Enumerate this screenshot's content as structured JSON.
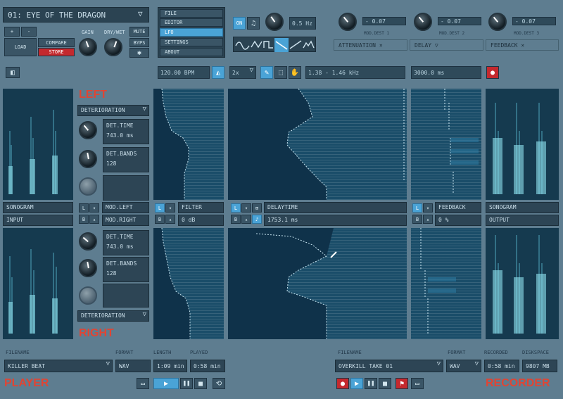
{
  "header": {
    "preset_name": "01: EYE OF THE DRAGON",
    "plus": "+",
    "minus": "-",
    "load": "LOAD",
    "compare": "COMPARE",
    "store": "STORE",
    "gain": "GAIN",
    "dry_wet": "DRY/WET",
    "mute": "MUTE",
    "byps": "BYPS"
  },
  "menu": [
    "FILE",
    "EDITOR",
    "LFO",
    "SETTINGS",
    "ABOUT"
  ],
  "lfo": {
    "on": "ON",
    "rate": "0.5 Hz"
  },
  "mod": {
    "items": [
      {
        "value": "- 0.07",
        "dest": "MOD.DEST 1",
        "label": "ATTENUATION"
      },
      {
        "value": "- 0.07",
        "dest": "MOD.DEST 2",
        "label": "DELAY"
      },
      {
        "value": "- 0.07",
        "dest": "MOD.DEST 3",
        "label": "FEEDBACK"
      }
    ],
    "attenuation_mark": "×",
    "delay_mark": "▽",
    "feedback_mark": "×"
  },
  "toolbar": {
    "bpm": "120.00 BPM",
    "multiplier": "2x",
    "freq_range": "1.38 - 1.46 kHz",
    "time": "3000.0 ms"
  },
  "channels": {
    "left": "LEFT",
    "right": "RIGHT",
    "deterioration": "DETERIORATION",
    "det_time": "DET.TIME",
    "det_time_value": "743.0 ms",
    "det_bands": "DET.BANDS",
    "det_bands_value": "128",
    "mod_left": "MOD.LEFT",
    "mod_right": "MOD.RIGHT"
  },
  "strips": {
    "sonogram": "SONOGRAM",
    "input": "INPUT",
    "filter": "FILTER",
    "filter_value": "0 dB",
    "delaytime": "DELAYTIME",
    "delaytime_value": "1753.1 ms",
    "feedback": "FEEDBACK",
    "feedback_value": "0 %",
    "sonogram_out": "SONOGRAM",
    "output": "OUTPUT",
    "l": "L",
    "b": "B"
  },
  "player": {
    "filename_lbl": "FILENAME",
    "format_lbl": "FORMAT",
    "length_lbl": "LENGTH",
    "played_lbl": "PLAYED",
    "filename": "KILLER BEAT",
    "format": "WAV",
    "length": "1:09 min",
    "played": "0:58 min",
    "title": "PLAYER"
  },
  "recorder": {
    "filename_lbl": "FILENAME",
    "format_lbl": "FORMAT",
    "recorded_lbl": "RECORDED",
    "diskspace_lbl": "DISKSPACE",
    "filename": "OVERKILL TAKE 01",
    "format": "WAV",
    "recorded": "0:58 min",
    "diskspace": "9807 MB",
    "title": "RECORDER"
  },
  "colors": {
    "accent": "#4aa3d6",
    "red": "#e04534",
    "panel": "#16425a"
  }
}
